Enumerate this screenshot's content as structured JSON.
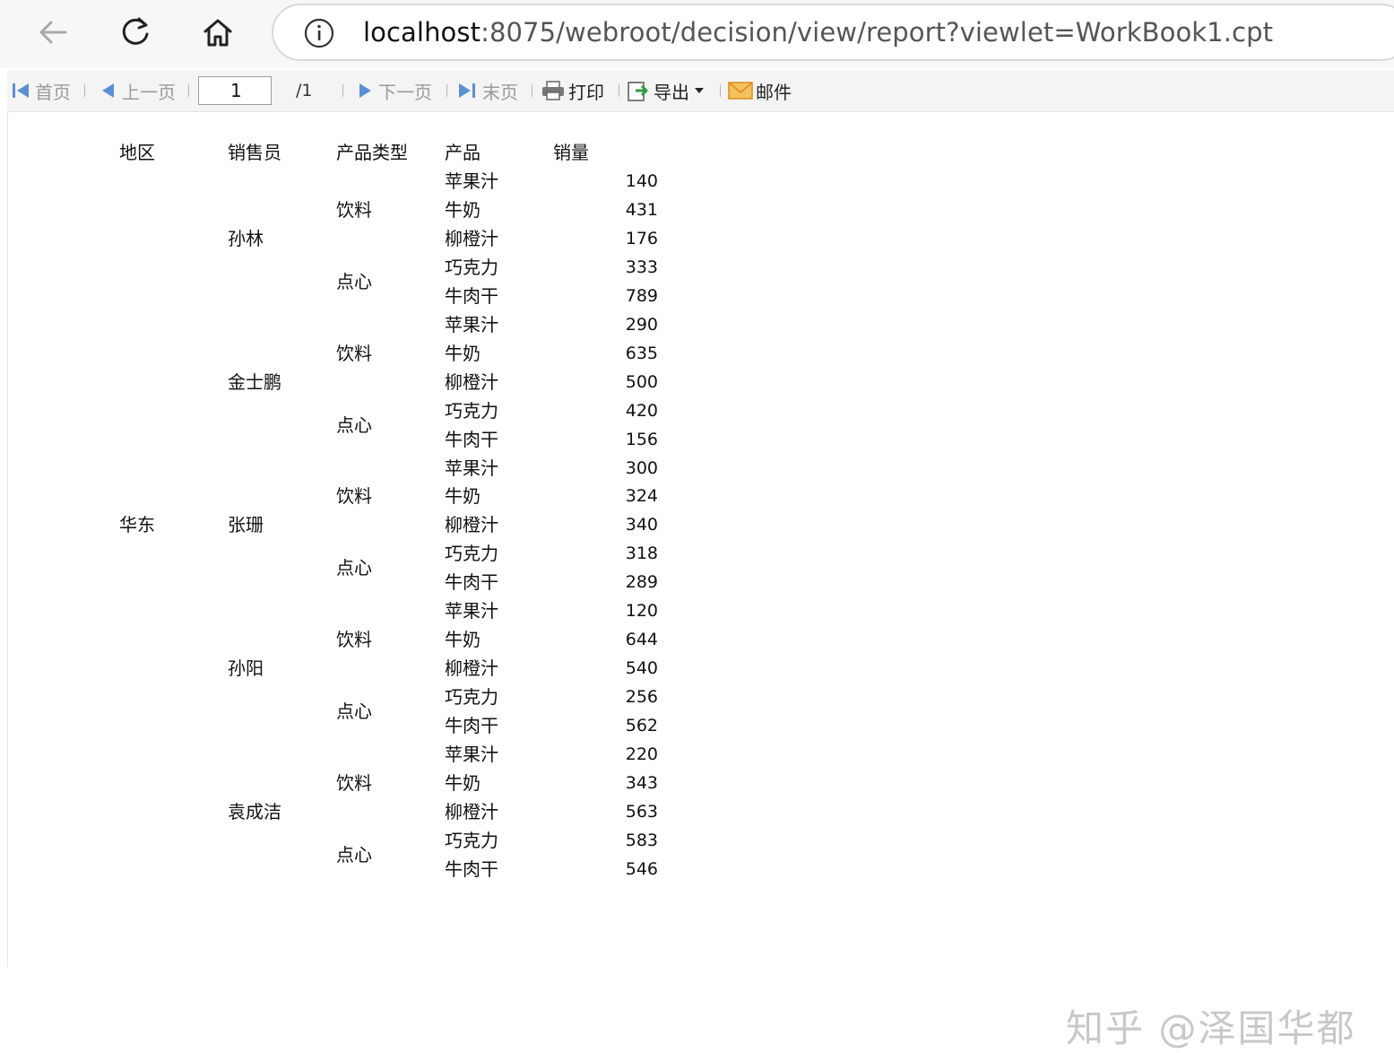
{
  "browser": {
    "url_host": "localhost",
    "url_path": ":8075/webroot/decision/view/report?viewlet=WorkBook1.cpt"
  },
  "toolbar": {
    "first": "首页",
    "prev": "上一页",
    "page_value": "1",
    "page_total": "/1",
    "next": "下一页",
    "last": "末页",
    "print": "打印",
    "export": "导出",
    "mail": "邮件"
  },
  "report": {
    "headers": [
      "地区",
      "销售员",
      "产品类型",
      "产品",
      "销量"
    ],
    "region": "华东",
    "salespeople": [
      {
        "name": "孙林",
        "groups": [
          {
            "type": "饮料",
            "rows": [
              {
                "product": "苹果汁",
                "qty": "140"
              },
              {
                "product": "牛奶",
                "qty": "431"
              },
              {
                "product": "柳橙汁",
                "qty": "176"
              }
            ]
          },
          {
            "type": "点心",
            "rows": [
              {
                "product": "巧克力",
                "qty": "333"
              },
              {
                "product": "牛肉干",
                "qty": "789"
              }
            ]
          }
        ]
      },
      {
        "name": "金士鹏",
        "groups": [
          {
            "type": "饮料",
            "rows": [
              {
                "product": "苹果汁",
                "qty": "290"
              },
              {
                "product": "牛奶",
                "qty": "635"
              },
              {
                "product": "柳橙汁",
                "qty": "500"
              }
            ]
          },
          {
            "type": "点心",
            "rows": [
              {
                "product": "巧克力",
                "qty": "420"
              },
              {
                "product": "牛肉干",
                "qty": "156"
              }
            ]
          }
        ]
      },
      {
        "name": "张珊",
        "groups": [
          {
            "type": "饮料",
            "rows": [
              {
                "product": "苹果汁",
                "qty": "300"
              },
              {
                "product": "牛奶",
                "qty": "324"
              },
              {
                "product": "柳橙汁",
                "qty": "340"
              }
            ]
          },
          {
            "type": "点心",
            "rows": [
              {
                "product": "巧克力",
                "qty": "318"
              },
              {
                "product": "牛肉干",
                "qty": "289"
              }
            ]
          }
        ]
      },
      {
        "name": "孙阳",
        "groups": [
          {
            "type": "饮料",
            "rows": [
              {
                "product": "苹果汁",
                "qty": "120"
              },
              {
                "product": "牛奶",
                "qty": "644"
              },
              {
                "product": "柳橙汁",
                "qty": "540"
              }
            ]
          },
          {
            "type": "点心",
            "rows": [
              {
                "product": "巧克力",
                "qty": "256"
              },
              {
                "product": "牛肉干",
                "qty": "562"
              }
            ]
          }
        ]
      },
      {
        "name": "袁成洁",
        "groups": [
          {
            "type": "饮料",
            "rows": [
              {
                "product": "苹果汁",
                "qty": "220"
              },
              {
                "product": "牛奶",
                "qty": "343"
              },
              {
                "product": "柳橙汁",
                "qty": "563"
              }
            ]
          },
          {
            "type": "点心",
            "rows": [
              {
                "product": "巧克力",
                "qty": "583"
              },
              {
                "product": "牛肉干",
                "qty": "546"
              }
            ]
          }
        ]
      }
    ]
  },
  "watermark": "知乎 @泽国华都",
  "colors": {
    "nav_arrow_blue": "#5b8fd6",
    "export_green": "#2e9b3e",
    "mail_orange": "#f0a030"
  }
}
